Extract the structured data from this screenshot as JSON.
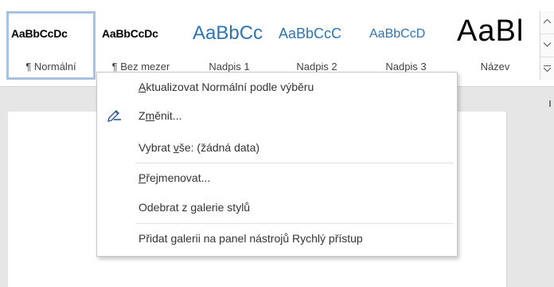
{
  "gallery": {
    "styles": [
      {
        "sample": "AaBbCcDc",
        "name": "¶ Normální",
        "selected": true
      },
      {
        "sample": "AaBbCcDc",
        "name": "¶ Bez mezer"
      },
      {
        "sample": "AaBbCc",
        "name": "Nadpis 1"
      },
      {
        "sample": "AaBbCcC",
        "name": "Nadpis 2"
      },
      {
        "sample": "AaBbCcD",
        "name": "Nadpis 3"
      },
      {
        "sample": "AaBl",
        "name": "Název"
      }
    ],
    "heading_color": "#2e74b5"
  },
  "menu": {
    "items": [
      {
        "pre": "",
        "u": "A",
        "post": "ktualizovat Normální podle výběru"
      },
      {
        "pre": "Z",
        "u": "m",
        "post": "ěnit...",
        "icon": "pen-style-icon"
      },
      {
        "pre": "Vybrat ",
        "u": "v",
        "post": "še: (žádná data)"
      },
      {
        "pre": "",
        "u": "P",
        "post": "řejmenovat..."
      },
      {
        "pre": "Odebrat z ",
        "u": "g",
        "post": "alerie stylů"
      },
      {
        "pre": "Přidat ",
        "u": "g",
        "post": "alerii na panel nástrojů Rychlý přístup"
      }
    ]
  }
}
